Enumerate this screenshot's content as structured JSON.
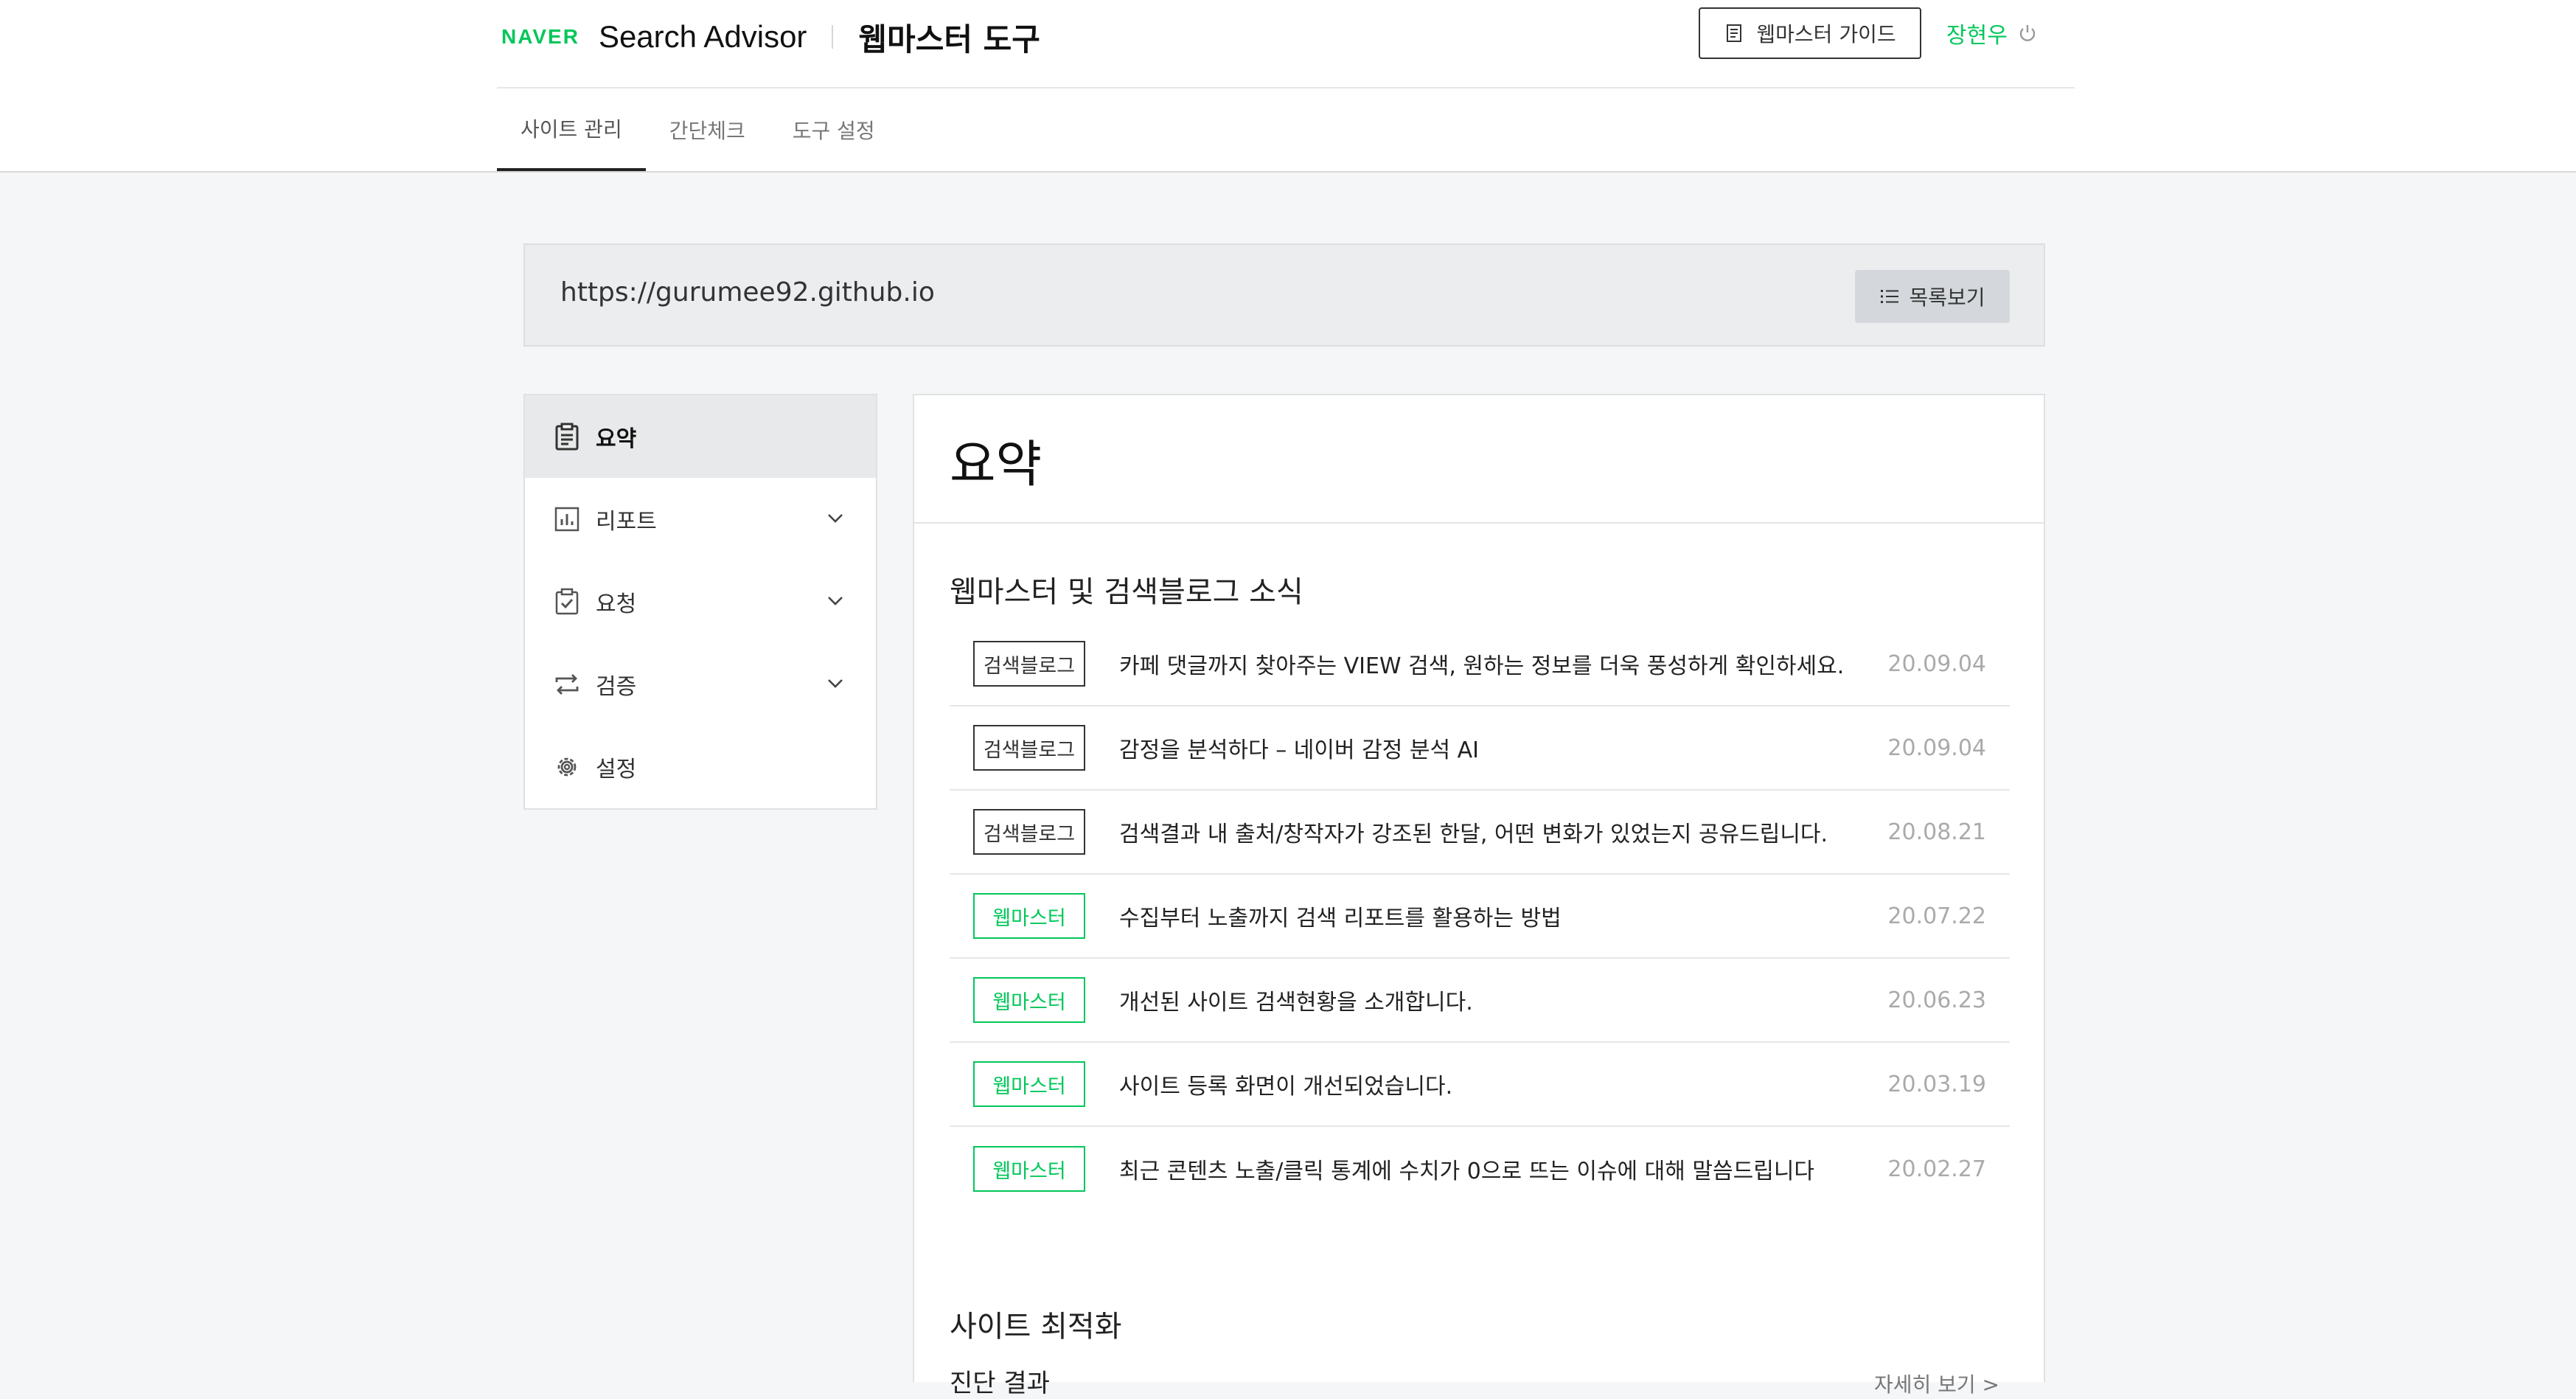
{
  "header": {
    "logo": "NAVER",
    "product": "Search Advisor",
    "tool_title": "웹마스터 도구",
    "guide_label": "웹마스터 가이드",
    "user_name": "장현우"
  },
  "tabs": [
    {
      "label": "사이트 관리"
    },
    {
      "label": "간단체크"
    },
    {
      "label": "도구 설정"
    }
  ],
  "site": {
    "url": "https://gurumee92.github.io",
    "list_label": "목록보기"
  },
  "sidebar": {
    "items": [
      {
        "label": "요약",
        "icon": "clipboard-icon"
      },
      {
        "label": "리포트",
        "icon": "bar-chart-icon"
      },
      {
        "label": "요청",
        "icon": "checklist-icon"
      },
      {
        "label": "검증",
        "icon": "repeat-icon"
      },
      {
        "label": "설정",
        "icon": "gear-icon"
      }
    ]
  },
  "main": {
    "title": "요약",
    "news_section_title": "웹마스터 및 검색블로그 소식",
    "news": [
      {
        "badge": "검색블로그",
        "text": "카페 댓글까지 찾아주는 VIEW 검색, 원하는 정보를 더욱 풍성하게 확인하세요.",
        "date": "20.09.04"
      },
      {
        "badge": "검색블로그",
        "text": "감정을 분석하다 – 네이버 감정 분석 AI",
        "date": "20.09.04"
      },
      {
        "badge": "검색블로그",
        "text": "검색결과 내 출처/창작자가 강조된 한달, 어떤 변화가 있었는지 공유드립니다.",
        "date": "20.08.21"
      },
      {
        "badge": "웹마스터",
        "text": "수집부터 노출까지 검색 리포트를 활용하는 방법",
        "date": "20.07.22"
      },
      {
        "badge": "웹마스터",
        "text": "개선된 사이트 검색현황을 소개합니다.",
        "date": "20.06.23"
      },
      {
        "badge": "웹마스터",
        "text": "사이트 등록 화면이 개선되었습니다.",
        "date": "20.03.19"
      },
      {
        "badge": "웹마스터",
        "text": "최근 콘텐츠 노출/클릭 통계에 수치가 0으로 뜨는 이슈에 대해 말씀드립니다",
        "date": "20.02.27"
      }
    ],
    "optimize_section_title": "사이트 최적화",
    "diagnosis_label": "진단 결과",
    "more_label": "자세히 보기 >"
  },
  "colors": {
    "accent": "#03c75a",
    "background": "#f5f6f7",
    "badge_default": "#333333"
  }
}
